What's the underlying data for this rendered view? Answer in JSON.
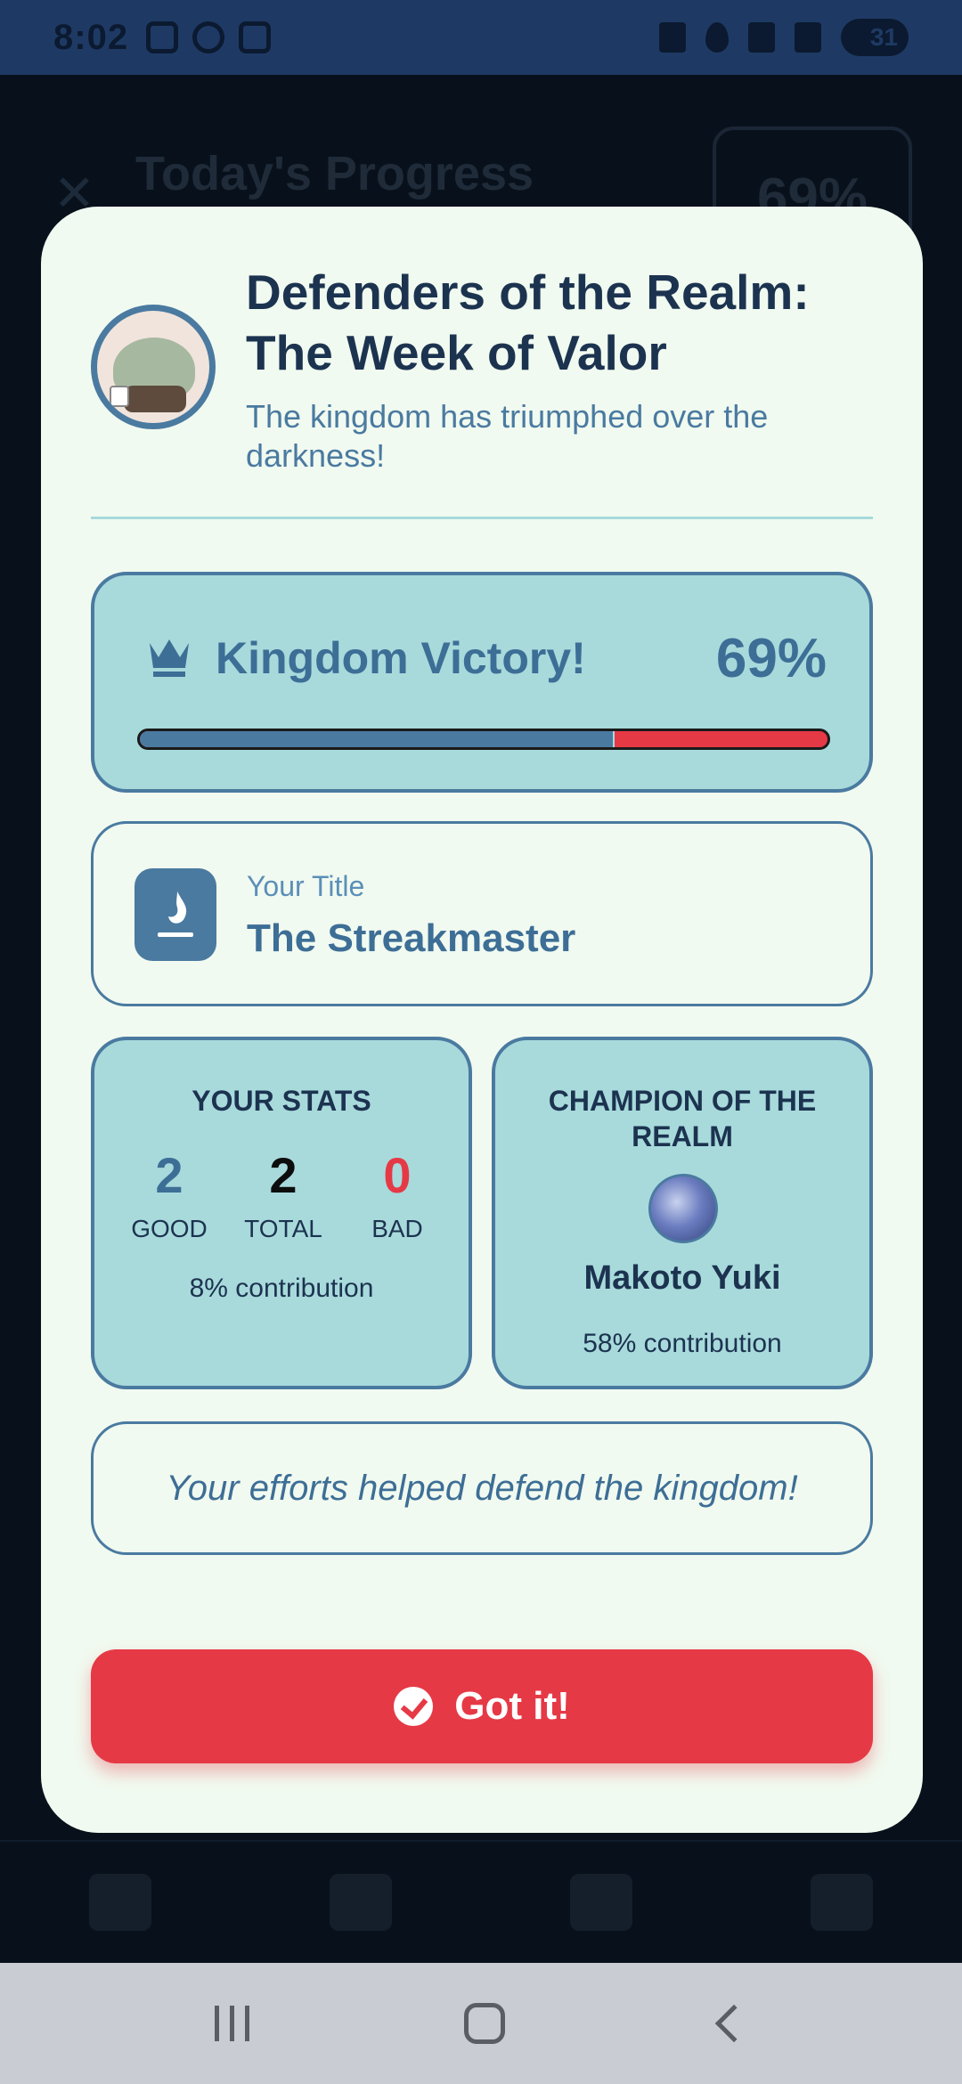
{
  "status_bar": {
    "time": "8:02",
    "battery": "31"
  },
  "background": {
    "title": "Today's Progress",
    "percent": "69%"
  },
  "modal": {
    "title": "Defenders of the Realm: The Week of Valor",
    "subtitle": "The kingdom has triumphed over the darkness!",
    "victory": {
      "label": "Kingdom Victory!",
      "percent_text": "69%",
      "progress": 0.69,
      "icon": "crown-icon"
    },
    "title_card": {
      "label": "Your Title",
      "value": "The Streakmaster",
      "icon": "flame-icon"
    },
    "your_stats": {
      "heading": "YOUR STATS",
      "good": {
        "value": "2",
        "label": "GOOD"
      },
      "total": {
        "value": "2",
        "label": "TOTAL"
      },
      "bad": {
        "value": "0",
        "label": "BAD"
      },
      "contribution": "8% contribution"
    },
    "champion": {
      "heading": "CHAMPION OF THE REALM",
      "name": "Makoto Yuki",
      "contribution": "58% contribution"
    },
    "message": "Your efforts helped defend the kingdom!",
    "button_label": "Got it!"
  },
  "colors": {
    "primary": "#4a7aa0",
    "accent_red": "#e63946",
    "card_bg": "#a8dadc",
    "modal_bg": "#f1faf0",
    "navy": "#1c3350"
  }
}
